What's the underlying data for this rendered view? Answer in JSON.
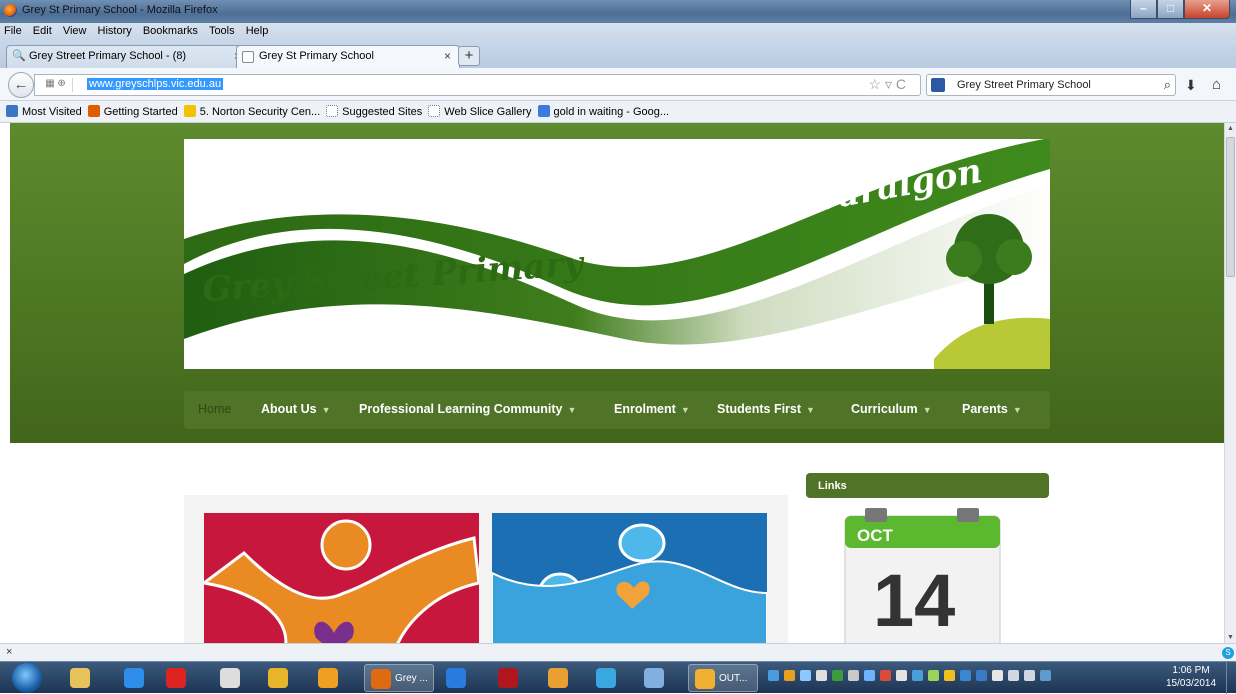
{
  "window": {
    "title": "Grey St Primary School - Mozilla Firefox"
  },
  "menubar": [
    "File",
    "Edit",
    "View",
    "History",
    "Bookmarks",
    "Tools",
    "Help"
  ],
  "tabs": [
    {
      "label": "Grey Street Primary School - (8)"
    },
    {
      "label": "Grey St Primary School"
    }
  ],
  "newtab_label": "+",
  "address": {
    "url": "www.greyschlps.vic.edu.au"
  },
  "search": {
    "engine": "Google",
    "value": "Grey Street Primary School"
  },
  "bookmarks": [
    {
      "label": "Most Visited",
      "color": "#3b76c4"
    },
    {
      "label": "Getting Started",
      "color": "#e05a00"
    },
    {
      "label": "5. Norton Security Cen...",
      "color": "#f2c200"
    },
    {
      "label": "Suggested Sites",
      "color": "#ffffff"
    },
    {
      "label": "Web Slice Gallery",
      "color": "#ffffff"
    },
    {
      "label": "gold in waiting - Goog...",
      "color": "#3b7be0"
    }
  ],
  "site": {
    "banner_left": "Grey Street Primary",
    "banner_right": "Traralgon",
    "nav": [
      {
        "label": "Home",
        "has_menu": false
      },
      {
        "label": "About Us",
        "has_menu": true
      },
      {
        "label": "Professional Learning Community",
        "has_menu": true
      },
      {
        "label": "Enrolment",
        "has_menu": true
      },
      {
        "label": "Students First",
        "has_menu": true
      },
      {
        "label": "Curriculum",
        "has_menu": true
      },
      {
        "label": "Parents",
        "has_menu": true
      }
    ],
    "sidebar_heading": "Links",
    "calendar": {
      "month": "OCT",
      "day": "14"
    },
    "colors": {
      "band": "#4a7220",
      "nav": "#4f7327",
      "tile1": "#c8173c",
      "tile2": "#1d6fb3"
    }
  },
  "findbar_close": "×",
  "taskbar": {
    "items": [
      {
        "name": "file-explorer",
        "label": ""
      },
      {
        "name": "internet-explorer",
        "label": ""
      },
      {
        "name": "pin-app",
        "label": ""
      },
      {
        "name": "clock-app",
        "label": ""
      },
      {
        "name": "chrome",
        "label": ""
      },
      {
        "name": "media-app",
        "label": ""
      },
      {
        "name": "firefox",
        "label": "Grey ..."
      },
      {
        "name": "lync",
        "label": ""
      },
      {
        "name": "red-app",
        "label": ""
      },
      {
        "name": "java",
        "label": ""
      },
      {
        "name": "math-app",
        "label": ""
      },
      {
        "name": "calc-app",
        "label": ""
      },
      {
        "name": "outlook",
        "label": "OUT..."
      }
    ],
    "time": "1:06 PM",
    "date": "15/03/2014"
  }
}
